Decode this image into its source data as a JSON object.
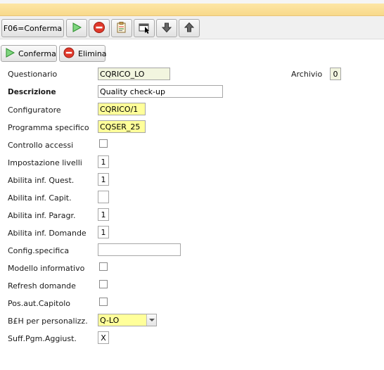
{
  "toolbar": {
    "confirm_f06_label": "F06=Conferma",
    "icons": [
      "play-icon",
      "stop-icon",
      "clipboard-icon",
      "window-pointer-icon",
      "arrow-down-icon",
      "arrow-up-icon"
    ]
  },
  "actions": {
    "confirm_label": "Conferma",
    "delete_label": "Elimina"
  },
  "form": {
    "questionario": {
      "label": "Questionario",
      "value": "CQRICO_LO"
    },
    "archivio": {
      "label": "Archivio",
      "value": "0"
    },
    "descrizione": {
      "label": "Descrizione",
      "value": "Quality check-up"
    },
    "configuratore": {
      "label": "Configuratore",
      "value": "CQRICO/1"
    },
    "programma_specifico": {
      "label": "Programma specifico",
      "value": "CQSER_25"
    },
    "controllo_accessi": {
      "label": "Controllo accessi",
      "checked": false
    },
    "impostazione_livelli": {
      "label": "Impostazione livelli",
      "value": "1"
    },
    "abilita_quest": {
      "label": "Abilita inf. Quest.",
      "value": "1"
    },
    "abilita_capit": {
      "label": "Abilita inf. Capit.",
      "value": ""
    },
    "abilita_paragr": {
      "label": "Abilita inf. Paragr.",
      "value": "1"
    },
    "abilita_domande": {
      "label": "Abilita inf. Domande",
      "value": "1"
    },
    "config_specifica": {
      "label": "Config.specifica",
      "value": ""
    },
    "modello_informativo": {
      "label": "Modello informativo",
      "checked": false
    },
    "refresh_domande": {
      "label": "Refresh domande",
      "checked": false
    },
    "pos_aut_capitolo": {
      "label": "Pos.aut.Capitolo",
      "checked": false
    },
    "beh_personalizz": {
      "label": "B£H per personalizz.",
      "value": "Q-LO"
    },
    "suff_pgm": {
      "label": "Suff.Pgm.Aggiust.",
      "value": "X"
    }
  },
  "colors": {
    "required_field": "#ffff9a",
    "readonly_field": "#f2f5df",
    "accent_bar": "#fde6a6"
  }
}
